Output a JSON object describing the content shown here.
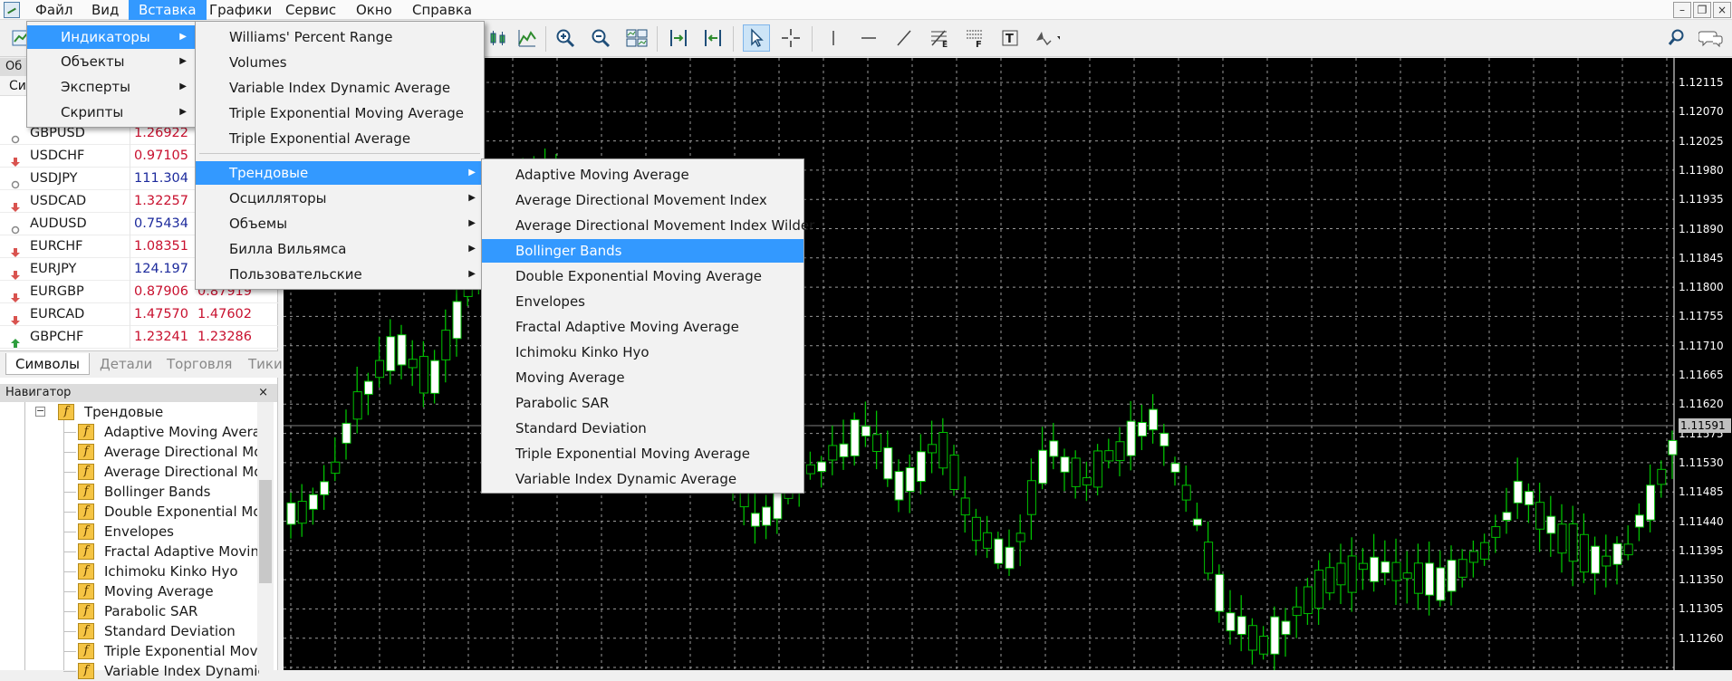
{
  "menubar": {
    "items": [
      "Файл",
      "Вид",
      "Вставка",
      "Графики",
      "Сервис",
      "Окно",
      "Справка"
    ],
    "active_index": 2
  },
  "window_controls": {
    "minimize": "–",
    "restore": "❐",
    "close": "×"
  },
  "market_watch": {
    "title": "Об",
    "column_header": "Си",
    "quotes": [
      {
        "symbol": "GBPUSD",
        "bid": "1.26922",
        "ask": "",
        "dir": "neutral",
        "color": "red"
      },
      {
        "symbol": "USDCHF",
        "bid": "0.97105",
        "ask": "",
        "dir": "down",
        "color": "red"
      },
      {
        "symbol": "USDJPY",
        "bid": "111.304",
        "ask": "",
        "dir": "neutral",
        "color": "blue"
      },
      {
        "symbol": "USDCAD",
        "bid": "1.32257",
        "ask": "",
        "dir": "down",
        "color": "red"
      },
      {
        "symbol": "AUDUSD",
        "bid": "0.75434",
        "ask": "",
        "dir": "neutral",
        "color": "blue"
      },
      {
        "symbol": "EURCHF",
        "bid": "1.08351",
        "ask": "",
        "dir": "down",
        "color": "red"
      },
      {
        "symbol": "EURJPY",
        "bid": "124.197",
        "ask": "",
        "dir": "down",
        "color": "blue"
      },
      {
        "symbol": "EURGBP",
        "bid": "0.87906",
        "ask": "0.87919",
        "dir": "down",
        "color": "red"
      },
      {
        "symbol": "EURCAD",
        "bid": "1.47570",
        "ask": "1.47602",
        "dir": "down",
        "color": "red"
      },
      {
        "symbol": "GBPCHF",
        "bid": "1.23241",
        "ask": "1.23286",
        "dir": "up",
        "color": "red"
      }
    ],
    "tabs": [
      "Символы",
      "Детали",
      "Торговля",
      "Тики"
    ],
    "active_tab": 0
  },
  "navigator": {
    "title": "Навигатор",
    "close": "×",
    "folder_label": "Трендовые",
    "folder_toggle": "−",
    "fx_glyph": "f",
    "items": [
      "Adaptive Moving Average",
      "Average Directional Movement Index",
      "Average Directional Movement Index Wilder",
      "Bollinger Bands",
      "Double Exponential Moving Average",
      "Envelopes",
      "Fractal Adaptive Moving Average",
      "Ichimoku Kinko Hyo",
      "Moving Average",
      "Parabolic SAR",
      "Standard Deviation",
      "Triple Exponential Moving Average",
      "Variable Index Dynamic Average"
    ]
  },
  "insert_menu": {
    "items": [
      "Индикаторы",
      "Объекты",
      "Эксперты",
      "Скрипты"
    ],
    "highlighted": 0
  },
  "indicators_menu": {
    "top_items": [
      "Williams' Percent Range",
      "Volumes",
      "Variable Index Dynamic Average",
      "Triple Exponential Moving Average",
      "Triple Exponential Average"
    ],
    "categories": [
      "Трендовые",
      "Осцилляторы",
      "Объемы",
      "Билла Вильямса",
      "Пользовательские"
    ],
    "highlighted_category": 0
  },
  "trend_menu": {
    "items": [
      "Adaptive Moving Average",
      "Average Directional Movement Index",
      "Average Directional Movement Index Wilder",
      "Bollinger Bands",
      "Double Exponential Moving Average",
      "Envelopes",
      "Fractal Adaptive Moving Average",
      "Ichimoku Kinko Hyo",
      "Moving Average",
      "Parabolic SAR",
      "Standard Deviation",
      "Triple Exponential Moving Average",
      "Variable Index Dynamic Average"
    ],
    "highlighted": 3
  },
  "chart": {
    "price_labels": [
      "1.12115",
      "1.12070",
      "1.12025",
      "1.11980",
      "1.11935",
      "1.11890",
      "1.11845",
      "1.11800",
      "1.11755",
      "1.11710",
      "1.11665",
      "1.11620",
      "1.11575",
      "1.11530",
      "1.11485",
      "1.11440",
      "1.11395",
      "1.11350",
      "1.11305",
      "1.11260"
    ],
    "current_price": "1.11591",
    "colors": {
      "background": "#000000",
      "bull_fill": "#ffffff",
      "wick": "#00c000",
      "grid": "#9a9a9a"
    }
  },
  "colors": {
    "accent": "#3399ff",
    "menu_bg": "#f2f2f2",
    "fx_icon": "#f5c444",
    "bid_red": "#c8102e",
    "bid_blue": "#1c2a9c"
  },
  "toolbar_icons": [
    "new-chart-icon",
    "bar-chart-icon",
    "candlestick-icon",
    "line-chart-icon",
    "zoom-in-icon",
    "zoom-out-icon",
    "tile-windows-icon",
    "chart-shift-icon",
    "autoscroll-icon",
    "cursor-icon",
    "crosshair-icon",
    "vertical-line-icon",
    "horizontal-line-icon",
    "trendline-icon",
    "fibonacci-icon",
    "fibo-fan-icon",
    "text-label-icon",
    "arrows-icon",
    "search-icon",
    "chat-icon"
  ]
}
